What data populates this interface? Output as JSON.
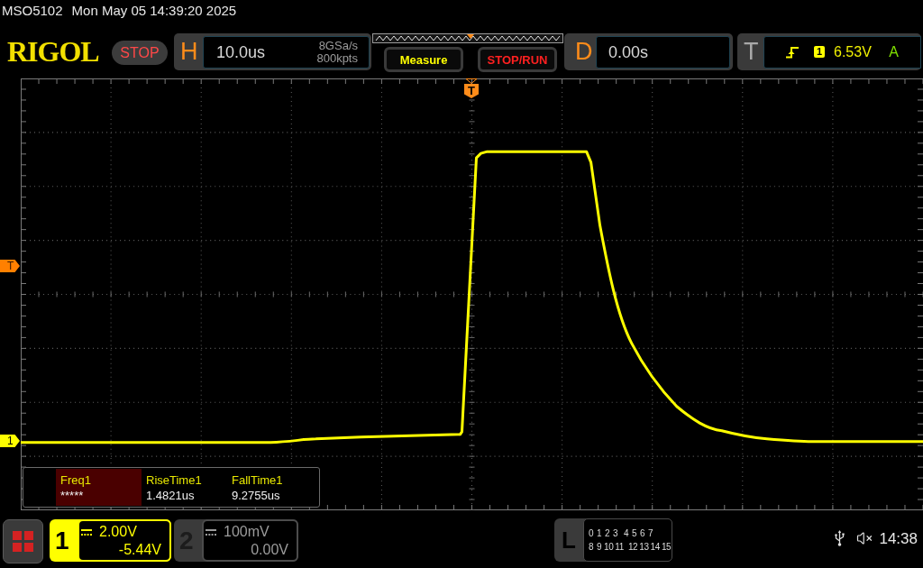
{
  "title_bar": {
    "model": "MSO5102",
    "datetime": "Mon May 05 14:39:20 2025"
  },
  "toolbar": {
    "logo": "RIGOL",
    "run_status": "STOP",
    "horizontal": {
      "label": "H",
      "timebase": "10.0us",
      "sample_rate": "8GSa/s",
      "memory_depth": "800kpts"
    },
    "buttons": [
      {
        "label": "Measure",
        "color": "#ffff00"
      },
      {
        "label": "STOP/RUN",
        "color": "#ff2020"
      }
    ],
    "delay": {
      "label": "D",
      "value": "0.00s"
    },
    "trigger": {
      "label": "T",
      "source": "1",
      "voltage": "6.53V",
      "mode": "A"
    }
  },
  "display": {
    "trigger_position_marker": "T",
    "trigger_level_marker": "T",
    "channel_marker": "1",
    "measurements": [
      {
        "name": "Freq1",
        "value": "*****",
        "selected": true
      },
      {
        "name": "RiseTime1",
        "value": "1.4821us",
        "selected": false
      },
      {
        "name": "FallTime1",
        "value": "9.2755us",
        "selected": false
      }
    ]
  },
  "bottom_bar": {
    "channels": [
      {
        "label": "1",
        "scale": "2.00V",
        "offset": "-5.44V",
        "enabled": true
      },
      {
        "label": "2",
        "scale": "100mV",
        "offset": "0.00V",
        "enabled": false
      }
    ],
    "logic": {
      "label": "L",
      "bits": [
        "0",
        "1",
        "2",
        "3",
        "4",
        "5",
        "6",
        "7",
        "8",
        "9",
        "10",
        "11",
        "12",
        "13",
        "14",
        "15"
      ]
    },
    "muted": true,
    "time": "14:38"
  }
}
